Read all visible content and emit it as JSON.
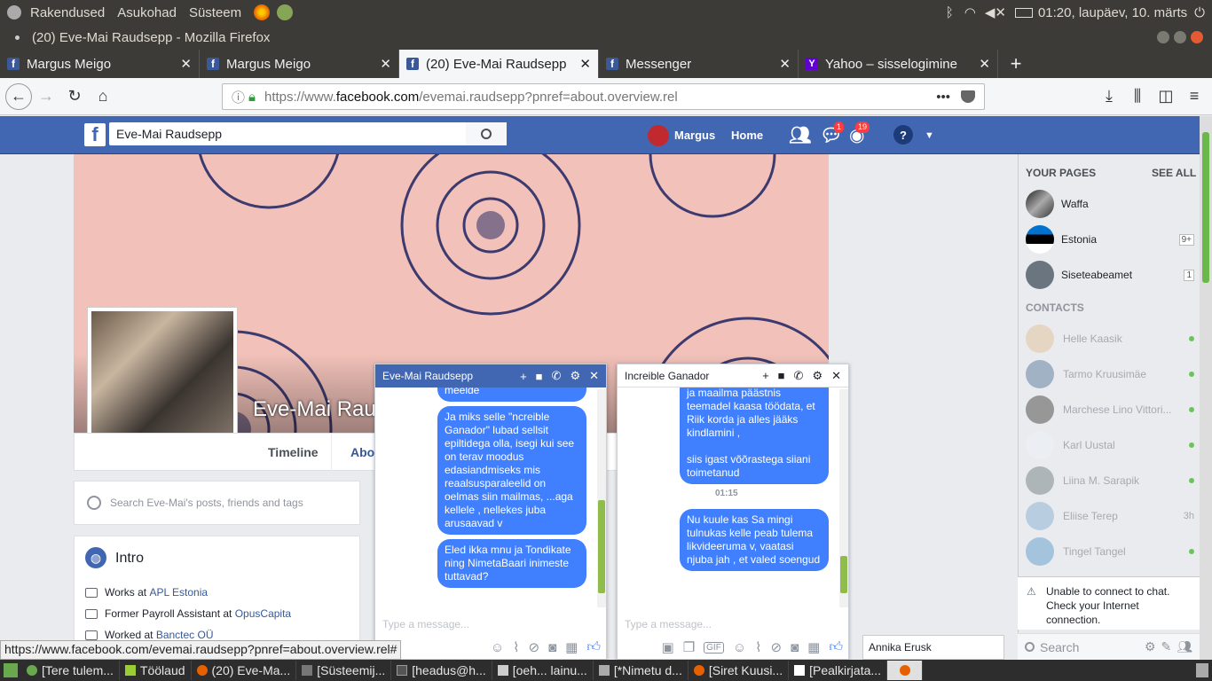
{
  "os_panel": {
    "menus": [
      "Rakendused",
      "Asukohad",
      "Süsteem"
    ],
    "clock": "01:20, laupäev, 10. märts"
  },
  "window": {
    "title": "(20) Eve-Mai Raudsepp - Mozilla Firefox"
  },
  "tabs": [
    {
      "label": "Margus Meigo",
      "icon": "facebook-icon"
    },
    {
      "label": "Margus Meigo",
      "icon": "facebook-icon"
    },
    {
      "label": "(20) Eve-Mai Raudsepp",
      "icon": "facebook-icon",
      "active": true
    },
    {
      "label": "Messenger",
      "icon": "facebook-icon"
    },
    {
      "label": "Yahoo – sisselogimine",
      "icon": "yahoo-icon"
    }
  ],
  "url": {
    "prefix": "https://www.",
    "domain": "facebook.com",
    "path": "/evemai.raudsepp?pnref=about.overview.rel"
  },
  "fb_header": {
    "search_value": "Eve-Mai Raudsepp",
    "user": "Margus",
    "home": "Home",
    "messages_badge": "1",
    "notifications_badge": "19"
  },
  "profile": {
    "name": "Eve-Mai Raud",
    "tabs": [
      "Timeline",
      "Abo"
    ],
    "search_placeholder": "Search Eve-Mai's posts, friends and tags"
  },
  "intro": {
    "title": "Intro",
    "rows": [
      {
        "pre": "Works at ",
        "link": "APL Estonia"
      },
      {
        "pre": "Former Payroll Assistant at ",
        "link": "OpusCapita"
      },
      {
        "pre": "Worked at ",
        "link": "Banctec OÜ"
      }
    ]
  },
  "your_pages": {
    "header": "YOUR PAGES",
    "see_all": "SEE ALL",
    "items": [
      {
        "name": "Waffa",
        "count": ""
      },
      {
        "name": "Estonia",
        "count": "9+"
      },
      {
        "name": "Siseteabeamet",
        "count": "1"
      }
    ]
  },
  "contacts": {
    "header": "CONTACTS",
    "items": [
      {
        "name": "Helle Kaasik",
        "status": ""
      },
      {
        "name": "Tarmo Kruusimäe",
        "status": ""
      },
      {
        "name": "Marchese Lino Vittori...",
        "status": ""
      },
      {
        "name": "Karl Uustal",
        "status": ""
      },
      {
        "name": "Liina M. Sarapik",
        "status": ""
      },
      {
        "name": "Eliise Terep",
        "status": "3h"
      },
      {
        "name": "Tingel Tangel",
        "status": ""
      }
    ]
  },
  "chat_offline": {
    "message": "Unable to connect to chat. Check your Internet connection."
  },
  "chat_search": {
    "placeholder": "Search"
  },
  "chat1": {
    "name": "Eve-Mai Raudsepp",
    "messages": [
      "meelde",
      "Ja miks selle \"ncreible Ganador\" lubad sellsit epiltidega olla, isegi kui see on terav moodus edasiandmiseks mis reaalsusparaleelid on oelmas siin mailmas, ...aga kellele , nellekes juba arusaavad v",
      "Eled ikka mnu ja Tondikate ning NimetaBaari inimeste tuttavad?"
    ],
    "input_placeholder": "Type a message..."
  },
  "chat2": {
    "name": "Increible Ganador",
    "messages": [
      "ja maailma päästnis teemadel kaasa töödata, et Riik korda ja alles jääks kindlamini ,\n\nsiis igast võõrastega siiani toimetanud",
      "Nu kuule kas Sa mingi tulnukas kelle peab tulema likvideeruma v, vaatasi njuba jah , et valed soengud"
    ],
    "time": "01:15",
    "input_placeholder": "Type a message..."
  },
  "chat_tab": {
    "name": "Annika Erusk"
  },
  "status_url": "https://www.facebook.com/evemai.raudsepp?pnref=about.overview.rel#",
  "taskbar": [
    {
      "label": "[Tere tulem...",
      "color": "#6aa84f"
    },
    {
      "label": "Töölaud",
      "color": "#9acd32"
    },
    {
      "label": "(20) Eve-Ma...",
      "color": "#e66000"
    },
    {
      "label": "[Süsteemij...",
      "color": "#777777"
    },
    {
      "label": "[headus@h...",
      "color": "#555555"
    },
    {
      "label": "[oeh... lainu...",
      "color": "#cccccc"
    },
    {
      "label": "[*Nimetu d...",
      "color": "#aaaaaa"
    },
    {
      "label": "[Siret Kuusi...",
      "color": "#e66000"
    },
    {
      "label": "[Pealkirjata...",
      "color": "#ffffff"
    }
  ]
}
